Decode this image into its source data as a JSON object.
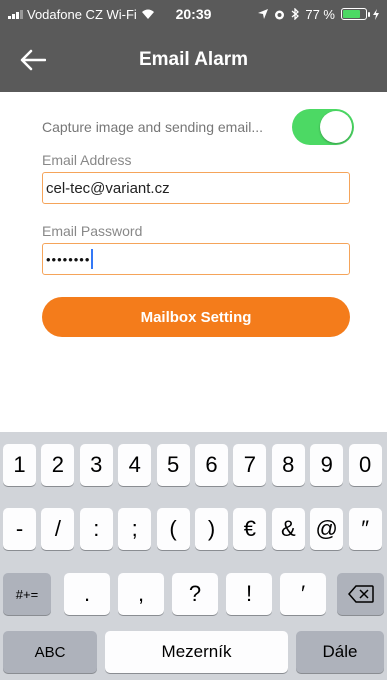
{
  "status_bar": {
    "carrier": "Vodafone CZ Wi-Fi",
    "time": "20:39",
    "battery": "77 %",
    "battery_level": 0.77,
    "battery_color": "#4cd964"
  },
  "nav": {
    "title": "Email Alarm",
    "back_icon": "arrow-left-icon"
  },
  "form": {
    "capture_label": "Capture image and sending email...",
    "capture_enabled": true,
    "email_label": "Email Address",
    "email_value": "cel-tec@variant.cz",
    "password_label": "Email Password",
    "password_value": "••••••••",
    "mailbox_button": "Mailbox Setting"
  },
  "colors": {
    "accent": "#f47c1b",
    "field_border": "#f5a45a",
    "toggle_on": "#4cd964",
    "header_bg": "#5a5a5a"
  },
  "keyboard": {
    "row1": [
      "1",
      "2",
      "3",
      "4",
      "5",
      "6",
      "7",
      "8",
      "9",
      "0"
    ],
    "row2": [
      "-",
      "/",
      ":",
      ";",
      "(",
      ")",
      "€",
      "&",
      "@",
      "″"
    ],
    "row3_left": "#+=",
    "row3": [
      ".",
      ",",
      "?",
      "!",
      "′"
    ],
    "delete_icon": "backspace-icon",
    "abc": "ABC",
    "space": "Mezerník",
    "return": "Dále"
  }
}
